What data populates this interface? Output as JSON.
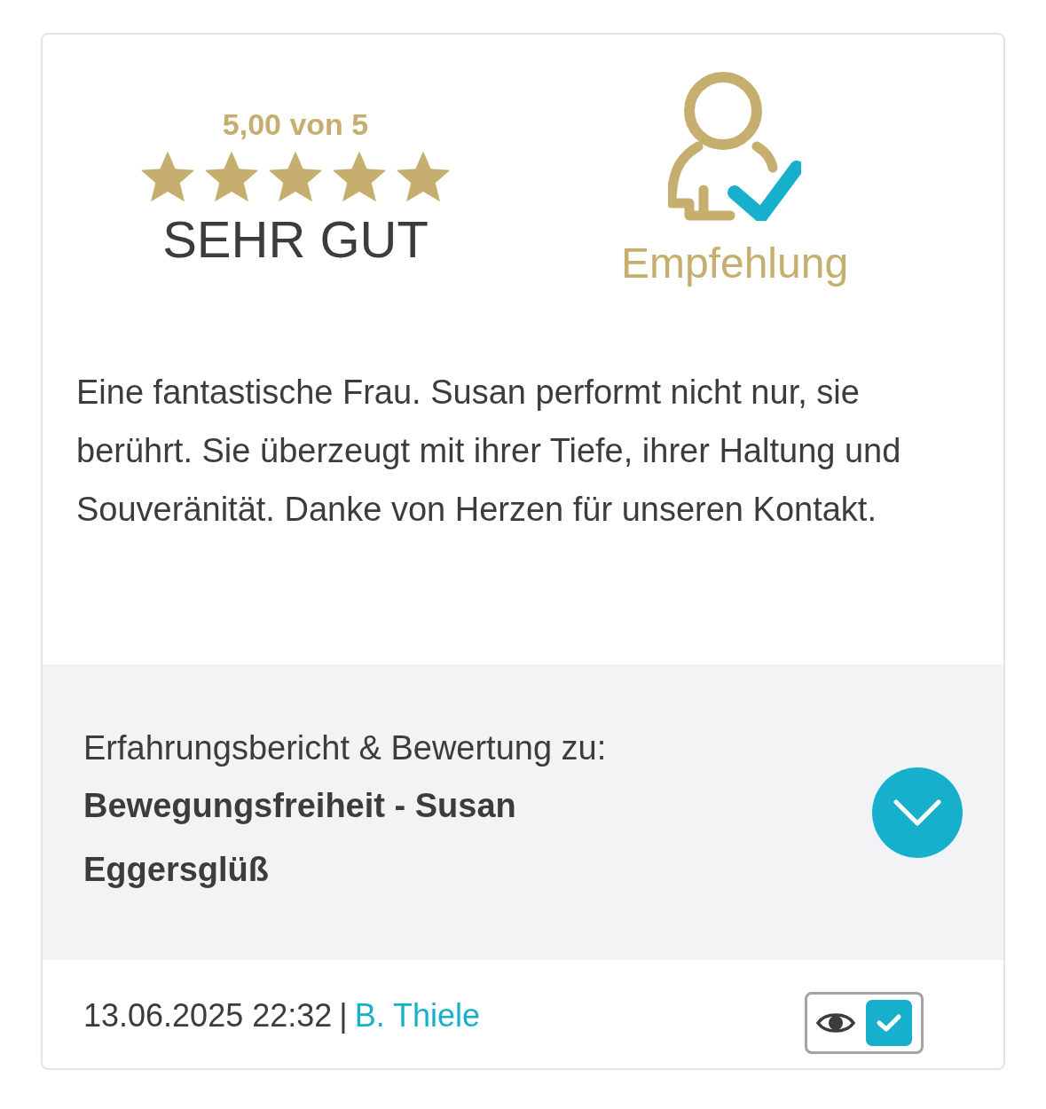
{
  "rating": {
    "score_text": "5,00 von 5",
    "stars": 5,
    "label": "SEHR GUT"
  },
  "recommendation": {
    "label": "Empfehlung"
  },
  "review_text": "Eine fantastische Frau. Susan performt nicht nur, sie berührt. Sie überzeugt mit ihrer Tiefe, ihrer Haltung und Souveränität. Danke von Herzen für unseren Kontakt.",
  "subject": {
    "intro": "Erfahrungsbericht & Bewertung zu:",
    "name": "Bewegungsfreiheit - Susan Eggersglüß",
    "expanded": false
  },
  "footer": {
    "date": "13.06.2025 22:32",
    "separator": "|",
    "author": "B. Thiele",
    "verified": true
  }
}
